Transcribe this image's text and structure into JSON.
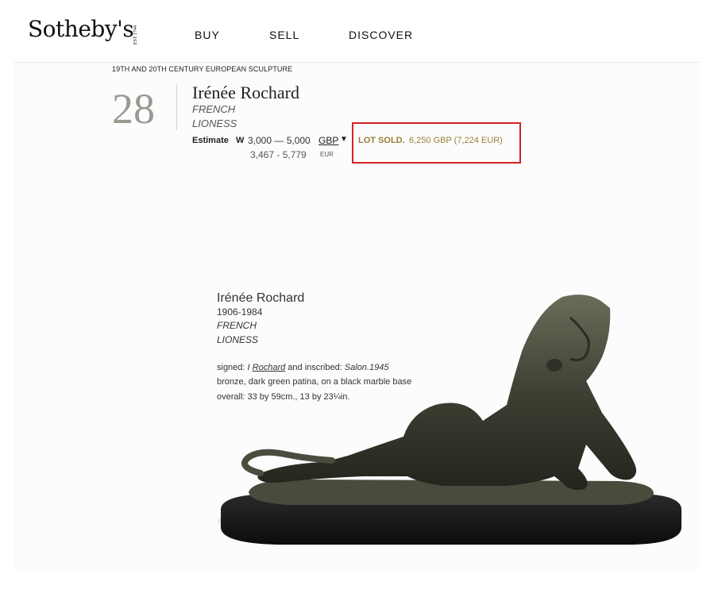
{
  "header": {
    "logo": "Sotheby's",
    "logo_est": "EST 1744",
    "nav": [
      "BUY",
      "SELL",
      "DISCOVER"
    ]
  },
  "lot": {
    "breadcrumb": "19TH AND 20TH CENTURY EUROPEAN SCULPTURE",
    "number": "28",
    "artist": "Irénée Rochard",
    "nationality": "FRENCH",
    "title": "LIONESS",
    "estimate_label": "Estimate",
    "estimate_symbol": "W",
    "estimate_range": "3,000 — 5,000",
    "estimate_currency": "GBP",
    "estimate_caret": "▼",
    "estimate_alt_range": "3,467 - 5,779",
    "estimate_alt_currency": "EUR",
    "sold_label": "LOT SOLD.",
    "sold_value": "6,250 GBP (7,224 EUR)",
    "highlight_color": "#d42222",
    "sold_color": "#9b7d3a"
  },
  "description": {
    "artist": "Irénée Rochard",
    "dates": "1906-1984",
    "nationality": "FRENCH",
    "title": "LIONESS",
    "signed_prefix": "signed: ",
    "signed_initial": "I ",
    "signed_name": "Rochard",
    "signed_middle": " and inscribed: ",
    "signed_inscription": "Salon.1945",
    "medium": "bronze, dark green patina, on a black marble base",
    "dimensions": "overall: 33 by 59cm., 13 by 23¼in."
  },
  "image": {
    "subject": "bronze-lioness-sculpture"
  }
}
